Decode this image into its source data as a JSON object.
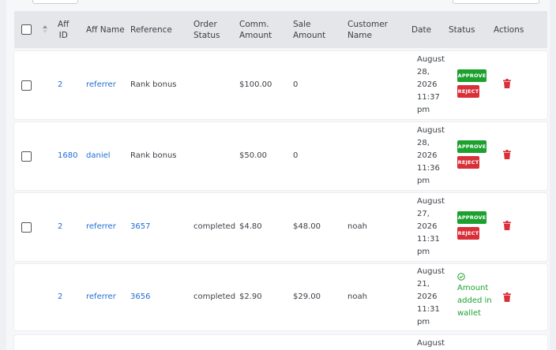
{
  "colors": {
    "approve": "#1ca12f",
    "reject": "#d82f38",
    "link": "#1f6fd1",
    "success_text": "#1ca12f"
  },
  "table": {
    "columns": {
      "aff_id": [
        "Aff",
        "ID"
      ],
      "aff_name": "Aff Name",
      "reference": "Reference",
      "order_status": [
        "Order",
        "Status"
      ],
      "comm_amount": [
        "Comm.",
        "Amount"
      ],
      "sale_amount": [
        "Sale",
        "Amount"
      ],
      "customer_name": [
        "Customer",
        "Name"
      ],
      "date": "Date",
      "status": "Status",
      "actions": "Actions"
    },
    "rows": [
      {
        "aff_id": "2",
        "aff_name": "referrer",
        "reference": "Rank bonus",
        "order_status": "",
        "comm": "$100.00",
        "sale": "0",
        "customer": "",
        "date": [
          "August",
          "28,",
          "2026",
          "11:37",
          "pm"
        ],
        "approve_label": "APPROVE",
        "reject_label": "REJECT"
      },
      {
        "aff_id": "1680",
        "aff_name": "daniel",
        "reference": "Rank bonus",
        "order_status": "",
        "comm": "$50.00",
        "sale": "0",
        "customer": "",
        "date": [
          "August",
          "28,",
          "2026",
          "11:36",
          "pm"
        ],
        "approve_label": "APPROVE",
        "reject_label": "REJECT"
      },
      {
        "aff_id": "2",
        "aff_name": "referrer",
        "reference": "3657",
        "order_status": "completed",
        "comm": "$4.80",
        "sale": "$48.00",
        "customer": "noah",
        "date": [
          "August",
          "27,",
          "2026",
          "11:31",
          "pm"
        ],
        "approve_label": "APPROVE",
        "reject_label": "REJECT"
      },
      {
        "aff_id": "2",
        "aff_name": "referrer",
        "reference": "3656",
        "order_status": "completed",
        "comm": "$2.90",
        "sale": "$29.00",
        "customer": "noah",
        "date": [
          "August",
          "21,",
          "2026",
          "11:31",
          "pm"
        ],
        "status_text": [
          "Amount",
          "added in",
          "wallet"
        ]
      },
      {
        "date": [
          "August"
        ]
      }
    ]
  },
  "icons": {
    "delete": "trash-icon",
    "added": "check-circle-icon",
    "sort": "sort-icon"
  }
}
